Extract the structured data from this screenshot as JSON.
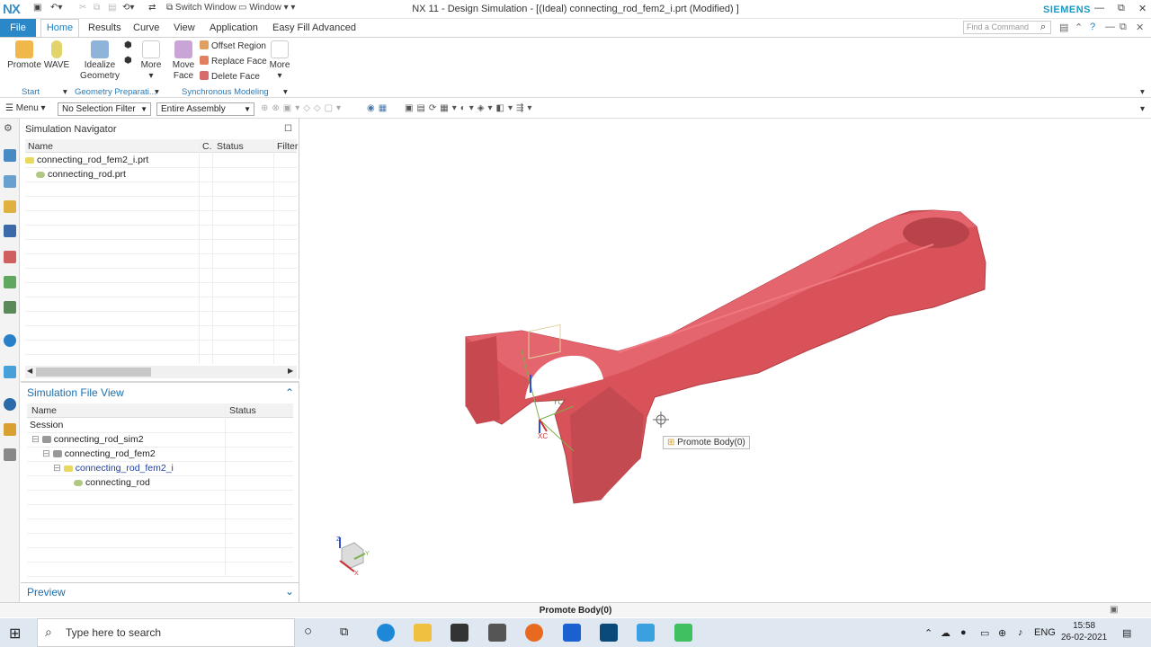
{
  "app": {
    "logo": "NX",
    "title": "NX 11 - Design Simulation - [(Ideal) connecting_rod_fem2_i.prt (Modified) ]",
    "brand": "SIEMENS",
    "switch_window": "Switch Window",
    "window_menu": "Window"
  },
  "tabs": {
    "file": "File",
    "home": "Home",
    "results": "Results",
    "curve": "Curve",
    "view": "View",
    "application": "Application",
    "easyfill": "Easy Fill Advanced"
  },
  "search": {
    "placeholder": "Find a Command"
  },
  "ribbon": {
    "promote": "Promote",
    "wave": "WAVE",
    "idealize": "Idealize",
    "geometry": "Geometry",
    "more1": "More",
    "move": "Move",
    "face": "Face",
    "more2": "More",
    "offset_region": "Offset Region",
    "replace_face": "Replace Face",
    "delete_face": "Delete Face",
    "grp_start": "Start",
    "grp_geom": "Geometry Preparati...",
    "grp_sync": "Synchronous Modeling"
  },
  "toolbar": {
    "menu": "Menu",
    "selection_filter": "No Selection Filter",
    "assembly": "Entire Assembly"
  },
  "nav": {
    "title": "Simulation Navigator",
    "col_name": "Name",
    "col_c": "C.",
    "col_status": "Status",
    "col_filter": "Filter",
    "rows": [
      "connecting_rod_fem2_i.prt",
      "connecting_rod.prt"
    ]
  },
  "fileview": {
    "title": "Simulation File View",
    "col_name": "Name",
    "col_status": "Status",
    "session": "Session",
    "rows": [
      "connecting_rod_sim2",
      "connecting_rod_fem2",
      "connecting_rod_fem2_i",
      "connecting_rod"
    ],
    "preview": "Preview"
  },
  "viewport": {
    "tooltip": "Promote Body(0)",
    "axis_yc": "YC",
    "axis_xc": "XC",
    "axis_z": "Z",
    "axis_x": "X",
    "axis_y": "Y"
  },
  "status": {
    "text": "Promote Body(0)"
  },
  "taskbar": {
    "search": "Type here to search",
    "lang": "ENG",
    "time": "15:58",
    "date": "26-02-2021"
  },
  "colors": {
    "accent": "#2a87c8",
    "part": "#d9525a"
  }
}
